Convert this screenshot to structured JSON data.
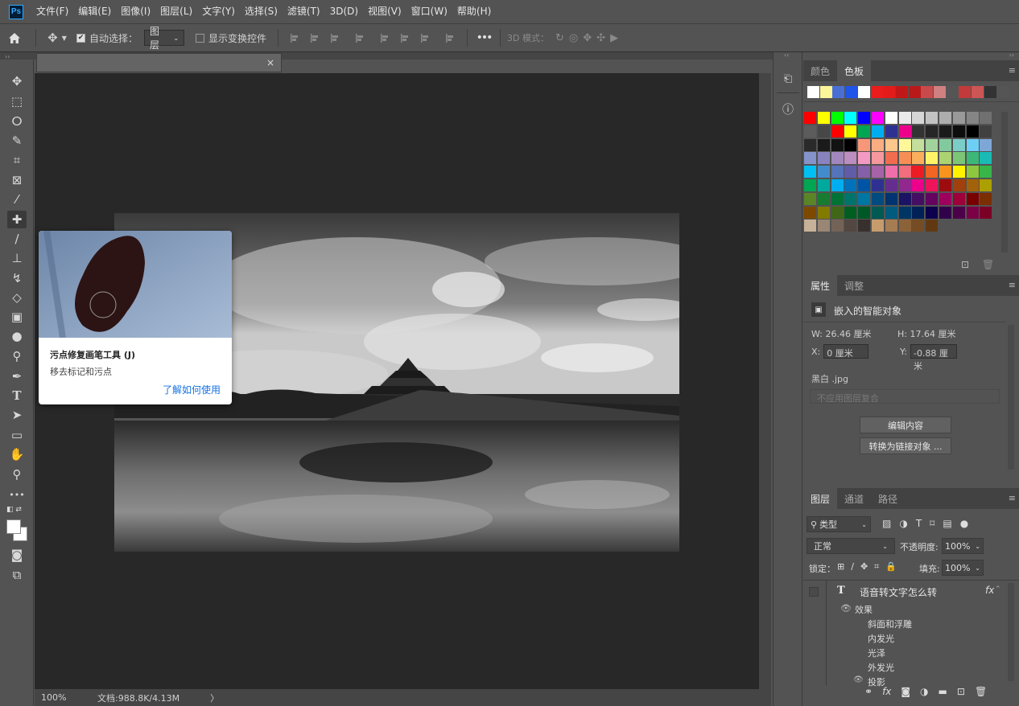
{
  "app": {
    "logo": "Ps"
  },
  "menu": [
    "文件(F)",
    "编辑(E)",
    "图像(I)",
    "图层(L)",
    "文字(Y)",
    "选择(S)",
    "滤镜(T)",
    "3D(D)",
    "视图(V)",
    "窗口(W)",
    "帮助(H)"
  ],
  "options": {
    "auto_select_label": "自动选择：",
    "auto_select_checked": true,
    "target_value": "图层",
    "show_transform_label": "显示变换控件",
    "show_transform_checked": false,
    "more": "•••",
    "mode_3d_label": "3D 模式："
  },
  "doc": {
    "close": "×"
  },
  "status": {
    "zoom": "100%",
    "doc_size": "文档:988.8K/4.13M",
    "arrow": "〉"
  },
  "tooltip": {
    "title": "污点修复画笔工具 (J)",
    "description": "移去标记和污点",
    "link": "了解如何使用"
  },
  "swatches_panel": {
    "tabs": [
      "颜色",
      "色板"
    ],
    "active_tab": 1,
    "recent": [
      "#ffffff",
      "#fdf59a",
      "#4a6fd4",
      "#1f55e8",
      "#ffffff",
      "#ea1c1c",
      "#e31b1b",
      "#c01818",
      "#b81a1a",
      "#c94a4a",
      "#d08080",
      "#555555",
      "#c33a3a",
      "#cc5555",
      "#333333",
      "#555555"
    ],
    "grid": [
      [
        "#ff0000",
        "#ffff00",
        "#00ff00",
        "#00ffff",
        "#0000ff",
        "#ff00ff",
        "#ffffff",
        "#ebebeb",
        "#d6d6d6",
        "#c2c2c2",
        "#adadad",
        "#999999",
        "#858585",
        "#707070"
      ],
      [
        "#5c5c5c",
        "#474747",
        "#ff0000",
        "#ffff00",
        "#00a651",
        "#00aeef",
        "#2e3192",
        "#ec008c",
        "#333333",
        "#262626",
        "#1a1a1a",
        "#0d0d0d",
        "#000000",
        "#404040"
      ],
      [
        "#2a2a2a",
        "#1a1a1a",
        "#121212",
        "#000000",
        "#f7977a",
        "#f9ad81",
        "#fdc68a",
        "#fff79a",
        "#c4df9b",
        "#a3d39c",
        "#82ca9d",
        "#7bcdc8",
        "#6ecff6",
        "#7ea7d8"
      ],
      [
        "#8493ca",
        "#8882be",
        "#a187be",
        "#bc8dbf",
        "#f49ac2",
        "#f6989d",
        "#f26c4f",
        "#f68e55",
        "#fbaf5c",
        "#fff467",
        "#acd372",
        "#7cc576",
        "#3bb878",
        "#1abbb4"
      ],
      [
        "#00bff3",
        "#438ccb",
        "#5574b9",
        "#605ca8",
        "#855fa8",
        "#a763a8",
        "#f06ea9",
        "#f26d7d",
        "#ed1c24",
        "#f26522",
        "#f7941d",
        "#fff200",
        "#8dc73f",
        "#39b54a"
      ],
      [
        "#00a651",
        "#00a99d",
        "#00aeef",
        "#0072bc",
        "#0054a6",
        "#2e3192",
        "#662d91",
        "#92278f",
        "#ec008c",
        "#ed145b",
        "#9e0b0f",
        "#a0410d",
        "#a36209",
        "#aba000"
      ],
      [
        "#598527",
        "#197b30",
        "#007236",
        "#00746b",
        "#0076a3",
        "#004b80",
        "#003471",
        "#1b1464",
        "#440e62",
        "#630460",
        "#9e005d",
        "#9e0039",
        "#790000",
        "#7b2e00"
      ],
      [
        "#7d4900",
        "#827b00",
        "#406618",
        "#005e20",
        "#005826",
        "#005952",
        "#005b7f",
        "#003663",
        "#002157",
        "#0d004c",
        "#32004b",
        "#4b0049",
        "#7b0046",
        "#7a0026"
      ],
      [
        "#c7b299",
        "#998675",
        "#736357",
        "#534741",
        "#37302d",
        "#c69c6d",
        "#a67c52",
        "#8c6239",
        "#754c24",
        "#603913"
      ]
    ]
  },
  "properties_panel": {
    "tabs": [
      "属性",
      "调整"
    ],
    "active_tab": 0,
    "kind": "嵌入的智能对象",
    "w_label": "W:",
    "w_value": "26.46 厘米",
    "h_label": "H:",
    "h_value": "17.64 厘米",
    "x_label": "X:",
    "x_value": "0 厘米",
    "y_label": "Y:",
    "y_value": "-0.88 厘米",
    "file": "黑白 .jpg",
    "comp_placeholder": "不应用图层复合",
    "edit_button": "编辑内容",
    "convert_button": "转换为链接对象 ..."
  },
  "layers_panel": {
    "tabs": [
      "图层",
      "通道",
      "路径"
    ],
    "active_tab": 0,
    "filter_label": "类型",
    "blend_mode": "正常",
    "opacity_label": "不透明度:",
    "opacity_value": "100%",
    "lock_label": "锁定：",
    "fill_label": "填充:",
    "fill_value": "100%",
    "layer_name": "语音转文字怎么转",
    "fx": "fx",
    "effects_label": "效果",
    "effects": [
      "斜面和浮雕",
      "内发光",
      "光泽",
      "外发光",
      "投影"
    ]
  }
}
